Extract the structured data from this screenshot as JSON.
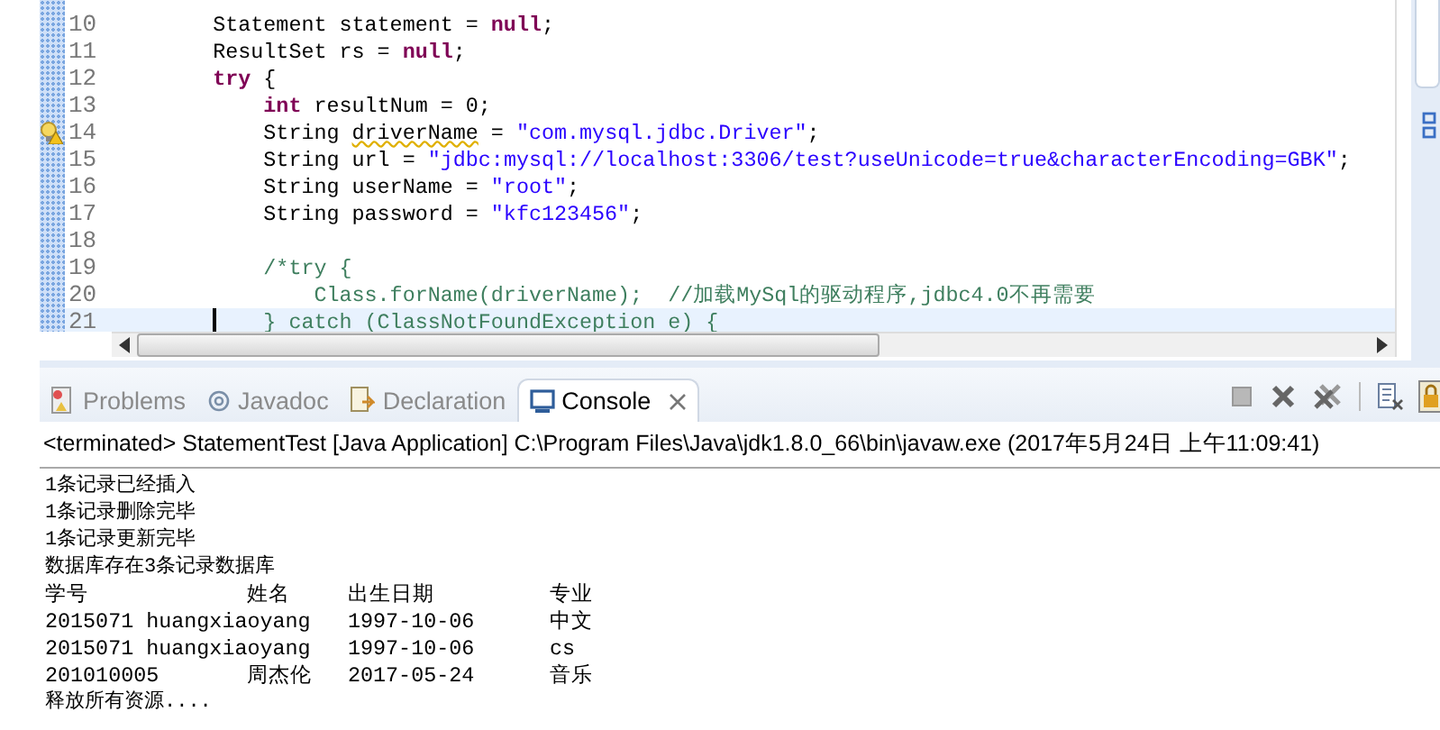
{
  "editor": {
    "lines": [
      {
        "number": "10",
        "warning": false,
        "current": false,
        "tokens": [
          {
            "kind": "plain",
            "text": "        Statement statement = "
          },
          {
            "kind": "keyword",
            "text": "null"
          },
          {
            "kind": "plain",
            "text": ";"
          }
        ]
      },
      {
        "number": "11",
        "warning": false,
        "current": false,
        "tokens": [
          {
            "kind": "plain",
            "text": "        ResultSet rs = "
          },
          {
            "kind": "keyword",
            "text": "null"
          },
          {
            "kind": "plain",
            "text": ";"
          }
        ]
      },
      {
        "number": "12",
        "warning": false,
        "current": false,
        "tokens": [
          {
            "kind": "keyword",
            "text": "        try"
          },
          {
            "kind": "plain",
            "text": " {"
          }
        ]
      },
      {
        "number": "13",
        "warning": false,
        "current": false,
        "tokens": [
          {
            "kind": "keyword",
            "text": "            int"
          },
          {
            "kind": "plain",
            "text": " resultNum = 0;"
          }
        ]
      },
      {
        "number": "14",
        "warning": true,
        "current": false,
        "tokens": [
          {
            "kind": "plain",
            "text": "            String "
          },
          {
            "kind": "warning",
            "text": "driverName"
          },
          {
            "kind": "plain",
            "text": " = "
          },
          {
            "kind": "string",
            "text": "\"com.mysql.jdbc.Driver\""
          },
          {
            "kind": "plain",
            "text": ";"
          }
        ]
      },
      {
        "number": "15",
        "warning": false,
        "current": false,
        "tokens": [
          {
            "kind": "plain",
            "text": "            String url = "
          },
          {
            "kind": "string",
            "text": "\"jdbc:mysql://localhost:3306/test?useUnicode=true&characterEncoding=GBK\""
          },
          {
            "kind": "plain",
            "text": ";"
          }
        ]
      },
      {
        "number": "16",
        "warning": false,
        "current": false,
        "tokens": [
          {
            "kind": "plain",
            "text": "            String userName = "
          },
          {
            "kind": "string",
            "text": "\"root\""
          },
          {
            "kind": "plain",
            "text": ";"
          }
        ]
      },
      {
        "number": "17",
        "warning": false,
        "current": false,
        "tokens": [
          {
            "kind": "plain",
            "text": "            String password = "
          },
          {
            "kind": "string",
            "text": "\"kfc123456\""
          },
          {
            "kind": "plain",
            "text": ";"
          }
        ]
      },
      {
        "number": "18",
        "warning": false,
        "current": false
      },
      {
        "number": "19",
        "warning": false,
        "current": false,
        "tokens": [
          {
            "kind": "comment",
            "text": "            /*try {"
          }
        ]
      },
      {
        "number": "20",
        "warning": false,
        "current": false,
        "tokens": [
          {
            "kind": "comment",
            "text": "                Class.forName(driverName);  //加载MySql的驱动程序,jdbc4.0不再需要"
          }
        ]
      },
      {
        "number": "21",
        "warning": false,
        "current": true,
        "tokens": [
          {
            "kind": "comment",
            "text": "            } catch (ClassNotFoundException e) {"
          }
        ]
      }
    ]
  },
  "tabs": [
    {
      "label": "Problems",
      "selected": false
    },
    {
      "label": "Javadoc",
      "selected": false
    },
    {
      "label": "Declaration",
      "selected": false
    },
    {
      "label": "Console",
      "selected": true
    }
  ],
  "console": {
    "header": "<terminated> StatementTest [Java Application] C:\\Program Files\\Java\\jdk1.8.0_66\\bin\\javaw.exe (2017年5月24日 上午11:09:41)",
    "lines": [
      {
        "kind": "text",
        "text": "1条记录已经插入"
      },
      {
        "kind": "text",
        "text": "1条记录删除完毕"
      },
      {
        "kind": "text",
        "text": "1条记录更新完毕"
      },
      {
        "kind": "text",
        "text": "数据库存在3条记录数据库"
      },
      {
        "kind": "row",
        "cells": [
          "学号",
          "姓名",
          "出生日期",
          "专业"
        ]
      },
      {
        "kind": "row",
        "cells": [
          "2015071 huangxiaoyang",
          "",
          "1997-10-06",
          "中文"
        ]
      },
      {
        "kind": "row",
        "cells": [
          "2015071 huangxiaoyang",
          "",
          "1997-10-06",
          "cs"
        ]
      },
      {
        "kind": "row",
        "cells": [
          "201010005",
          "周杰伦",
          "2017-05-24",
          "音乐"
        ]
      },
      {
        "kind": "text",
        "text": "释放所有资源...."
      }
    ]
  }
}
